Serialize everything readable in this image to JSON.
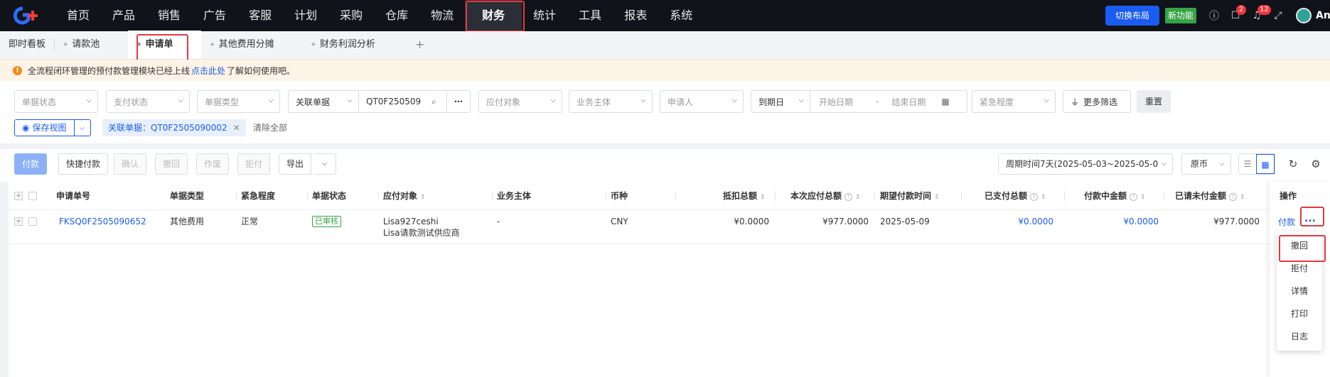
{
  "nav": {
    "menu": [
      "首页",
      "产品",
      "销售",
      "广告",
      "客服",
      "计划",
      "采购",
      "仓库",
      "物流",
      "财务",
      "统计",
      "工具",
      "报表",
      "系统"
    ],
    "active": "财务",
    "switch_layout": "切换布局",
    "new_feature": "新功能",
    "badge_msg": "2",
    "badge_bell": "12",
    "user": "Ann"
  },
  "tabs": [
    "即时看板",
    "请款池",
    "申请单",
    "其他费用分摊",
    "财务利润分析"
  ],
  "active_tab": "申请单",
  "notice": {
    "text_before": "全流程闭环管理的预付款管理模块已经上线",
    "link": "点击此处",
    "text_after": "了解如何使用吧。"
  },
  "filters": {
    "doc_status": "单据状态",
    "pay_status": "支付状态",
    "doc_type": "单据类型",
    "related_doc": "关联单据",
    "related_value": "QT0F250509",
    "payee": "应付对象",
    "entity": "业务主体",
    "applicant": "申请人",
    "due_date": "到期日",
    "start_date": "开始日期",
    "date_sep": "-",
    "end_date": "结束日期",
    "urgency": "紧急程度",
    "more": "更多筛选",
    "reset": "重置",
    "save_view": "保存视图",
    "tag": "关联单据：QT0F2505090002",
    "clear_all": "清除全部"
  },
  "toolbar": {
    "pay": "付款",
    "quick_pay": "快捷付款",
    "confirm": "确认",
    "revoke": "撤回",
    "void": "作废",
    "reject": "拒付",
    "export": "导出",
    "period": "周期时间7天(2025-05-03~2025-05-09)",
    "currency": "原币"
  },
  "table": {
    "headers": [
      "申请单号",
      "单据类型",
      "紧急程度",
      "单据状态",
      "应付对象",
      "业务主体",
      "币种",
      "抵扣总额",
      "本次应付总额",
      "期望付款时间",
      "已支付总额",
      "付款中金额",
      "已请未付金额"
    ],
    "op_header": "操作",
    "rows": [
      {
        "no": "FKSQ0F2505090652",
        "type": "其他费用",
        "urgency": "正常",
        "status": "已审核",
        "payee_1": "Lisa927ceshi",
        "payee_2": "Lisa请款测试供应商",
        "entity": "-",
        "currency": "CNY",
        "deduct": "¥0.0000",
        "payable": "¥977.0000",
        "expect_date": "2025-05-09",
        "paid": "¥0.0000",
        "paying": "¥0.0000",
        "unpaid": "¥977.0000"
      }
    ],
    "op_pay": "付款",
    "op_more": "..."
  },
  "dropdown": [
    "撤回",
    "拒付",
    "详情",
    "打印",
    "日志"
  ]
}
